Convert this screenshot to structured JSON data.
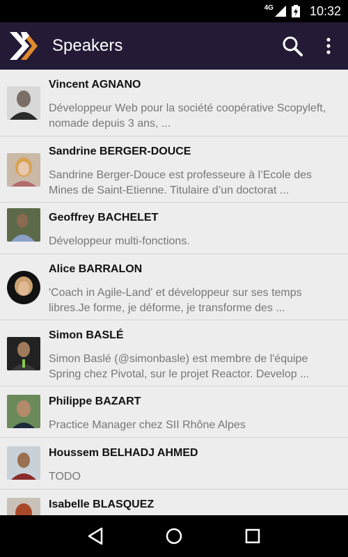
{
  "status_bar": {
    "network": "4G",
    "time": "10:32"
  },
  "app_bar": {
    "title": "Speakers",
    "logo_icon": "x-logo-icon",
    "search_icon": "search-icon",
    "menu_icon": "more-vert-icon",
    "background": "#241a36",
    "accent": "#e08a2c"
  },
  "speakers": [
    {
      "name": "Vincent AGNANO",
      "description": "Développeur Web pour la société coopérative Scopyleft, nomade depuis 3 ans, ..."
    },
    {
      "name": "Sandrine BERGER-DOUCE",
      "description": "Sandrine Berger-Douce est professeure à l’Ecole des Mines de Saint-Etienne. Titulaire d’un doctorat ..."
    },
    {
      "name": "Geoffrey BACHELET",
      "description": "Développeur multi-fonctions."
    },
    {
      "name": "Alice BARRALON",
      "description": "'Coach in Agile-Land' et développeur sur ses temps libres.Je forme, je déforme, je transforme des ..."
    },
    {
      "name": "Simon BASLÉ",
      "description": "Simon Baslé (@simonbasle) est membre de l'équipe Spring chez Pivotal, sur le projet Reactor. Develop ..."
    },
    {
      "name": "Philippe BAZART",
      "description": "Practice Manager chez SII Rhône Alpes"
    },
    {
      "name": "Houssem BELHADJ AHMED",
      "description": "TODO"
    },
    {
      "name": "Isabelle BLASQUEZ",
      "description": ""
    }
  ],
  "nav_bar": {
    "back_icon": "back-triangle-icon",
    "home_icon": "home-circle-icon",
    "recents_icon": "recents-square-icon"
  }
}
